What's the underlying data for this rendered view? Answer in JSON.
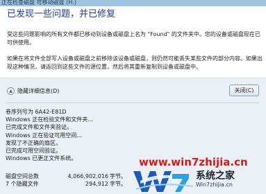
{
  "window": {
    "title": "正在检查磁盘 可移动磁盘 (H:)"
  },
  "dialog": {
    "heading": "已发现一些问题，并已修复",
    "paragraph1": "受这些问题影响的所有文件都已移动到设备或磁盘上名为 \"Found\" 的文件夹中。您的设备或磁盘现在已可供使用。",
    "paragraph2": "如果在将文件全部写入设备或磁盘之前移除该设备或磁盘，则仍然可能丢失某些文件的部分内容。如果出现这种情况，请返回到这些文件的源位置，然后将其重新复制到设备或磁盘中。",
    "toggle_label": "隐藏详细信息(D)",
    "close_label": "关闭(C)"
  },
  "details": {
    "lines": [
      "卷序列号为 6A42-E81D",
      "Windows 正在检验文件和文件夹...",
      "已完成文件和文件夹验证。",
      "Windows 正在验证可用空间...",
      "发现了不正确的扇区。",
      "已完成可用空间验证。",
      "Windows 已更正文件系统。"
    ],
    "stats": [
      {
        "label": "磁盘空间总数",
        "value": "4,066,902,016",
        "unit": "字节。"
      },
      {
        "label": "7 个隐藏文件",
        "value": "294,912",
        "unit": "字节。"
      }
    ]
  },
  "watermark": {
    "url": "www.win7zhijia.cn",
    "brand": "系统之家",
    "brand_sub": "Win7zhijia.cn",
    "color": "#d41b1b"
  }
}
